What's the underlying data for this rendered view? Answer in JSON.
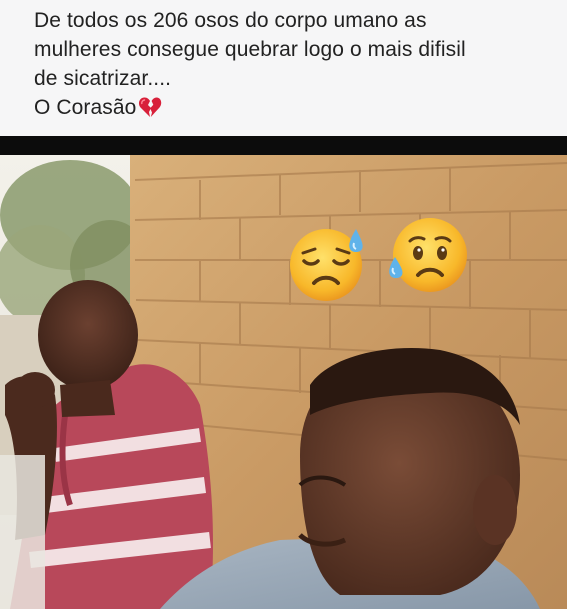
{
  "caption": {
    "lines": [
      "De todos os 206 osos do corpo umano as",
      "mulheres consegue quebrar logo o mais difisil",
      "de sicatrizar....",
      "O Corasão"
    ],
    "trailing_emoji": "broken-heart-icon"
  },
  "photo": {
    "overlay_emojis": [
      "sad-but-relieved-face-icon",
      "sad-face-with-sweat-icon"
    ]
  }
}
